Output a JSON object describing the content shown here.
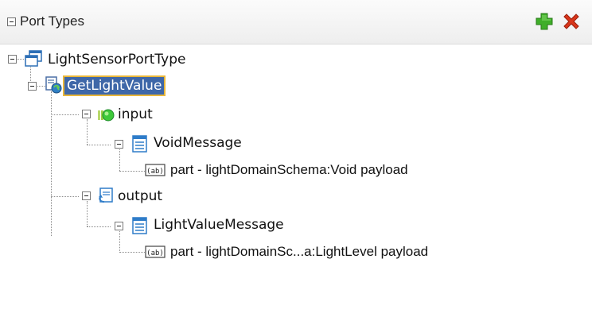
{
  "panel": {
    "title": "Port Types",
    "add_icon": "plus-icon",
    "delete_icon": "x-icon"
  },
  "tree": {
    "port_type": {
      "label": "LightSensorPortType",
      "icon": "porttype-icon"
    },
    "operation": {
      "label": "GetLightValue",
      "icon": "operation-icon",
      "selected": true
    },
    "input": {
      "label": "input",
      "icon": "input-icon"
    },
    "input_message": {
      "label": "VoidMessage",
      "icon": "message-icon"
    },
    "input_part": {
      "label": "part - lightDomainSchema:Void payload",
      "icon": "part-icon",
      "badge": "ab"
    },
    "output": {
      "label": "output",
      "icon": "output-icon"
    },
    "output_message": {
      "label": "LightValueMessage",
      "icon": "message-icon"
    },
    "output_part": {
      "label": "part - lightDomainSc...a:LightLevel payload",
      "icon": "part-icon",
      "badge": "ab"
    }
  },
  "colors": {
    "selection_bg": "#3e67a8",
    "selection_border": "#e9b73a",
    "add_green": "#3fae29",
    "delete_red": "#d9361b"
  }
}
